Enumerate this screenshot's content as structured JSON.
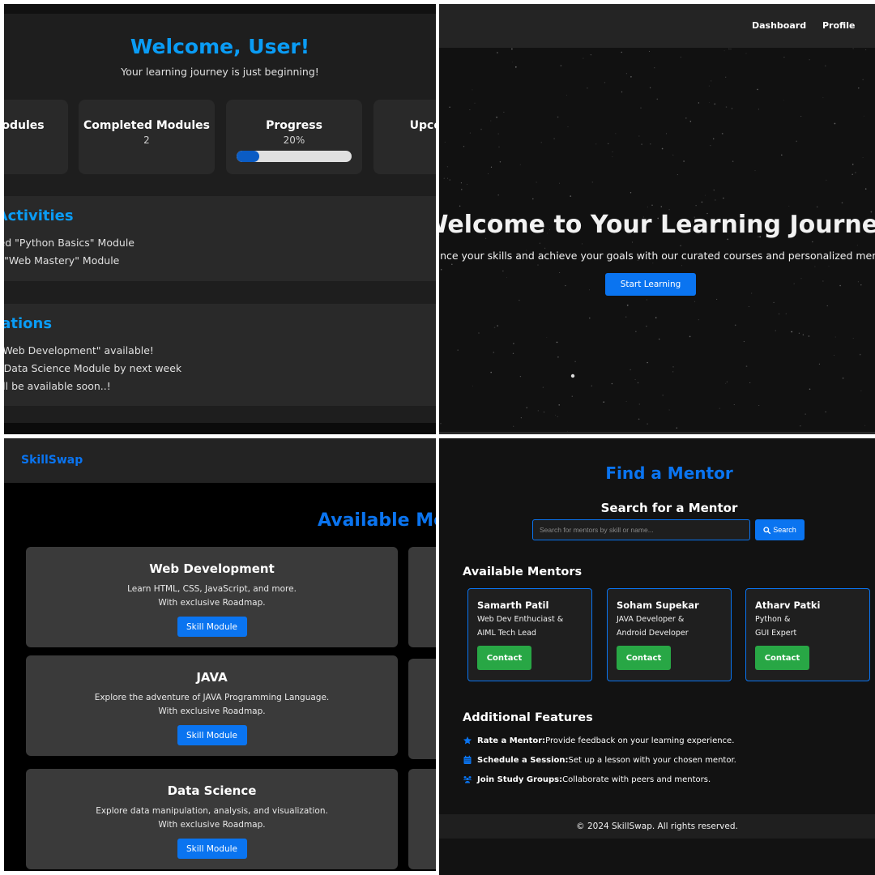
{
  "dashboard": {
    "welcome": "Welcome, User!",
    "subtitle": "Your learning journey is just beginning!",
    "stats": {
      "total_label": "Total Modules",
      "completed_label": "Completed Modules",
      "completed_value": "2",
      "progress_label": "Progress",
      "progress_value": "20%",
      "progress_fraction": 0.2,
      "upcoming_label": "Upcoming"
    },
    "activities": {
      "title": "Recent Activities",
      "items": [
        "Completed \"Python Basics\" Module",
        "Started \"Web Mastery\" Module"
      ]
    },
    "notifications": {
      "title": "Notifications",
      "items": [
        "New Module \"Web Development\" available!",
        "Reminder: Finish Data Science Module by next week",
        "Mentor Booking will be available soon..!"
      ]
    }
  },
  "hero": {
    "nav": [
      "Dashboard",
      "Profile"
    ],
    "title": "Welcome to Your Learning Journey",
    "subtitle": "Enhance your skills and achieve your goals with our curated courses and personalized mentors.",
    "cta": "Start Learning"
  },
  "modules": {
    "logo": "SkillSwap",
    "title": "Available Modules",
    "cards": [
      {
        "title": "Web Development",
        "desc": "Learn HTML, CSS, JavaScript, and more.",
        "roadmap": "With exclusive Roadmap.",
        "button": "Skill Module"
      },
      {
        "title": "JAVA",
        "desc": "Explore the adventure of JAVA Programming Language.",
        "roadmap": "With exclusive Roadmap.",
        "button": "Skill Module"
      },
      {
        "title": "Data Science",
        "desc": "Explore data manipulation, analysis, and visualization.",
        "roadmap": "With exclusive Roadmap.",
        "button": "Skill Module"
      }
    ]
  },
  "mentor": {
    "title": "Find a Mentor",
    "search_title": "Search for a Mentor",
    "search_placeholder": "Search for mentors by skill or name...",
    "search_button": "Search",
    "available_title": "Available Mentors",
    "mentors": [
      {
        "name": "Samarth Patil",
        "role1": "Web Dev Enthuciast &",
        "role2": "AIML Tech Lead",
        "button": "Contact"
      },
      {
        "name": "Soham Supekar",
        "role1": "JAVA Developer &",
        "role2": "Android Developer",
        "button": "Contact"
      },
      {
        "name": "Atharv Patki",
        "role1": "Python &",
        "role2": "GUI Expert",
        "button": "Contact"
      }
    ],
    "features_title": "Additional Features",
    "features": [
      {
        "icon": "star-icon",
        "label": "Rate a Mentor:",
        "text": "Provide feedback on your learning experience."
      },
      {
        "icon": "calendar-icon",
        "label": "Schedule a Session:",
        "text": "Set up a lesson with your chosen mentor."
      },
      {
        "icon": "users-icon",
        "label": "Join Study Groups:",
        "text": "Collaborate with peers and mentors."
      }
    ],
    "footer": "© 2024 SkillSwap. All rights reserved."
  },
  "colors": {
    "accent_blue": "#0a74f0",
    "heading_blue": "#0a9cf5",
    "progress_fill": "#0b5cc4",
    "contact_green": "#28a745"
  }
}
